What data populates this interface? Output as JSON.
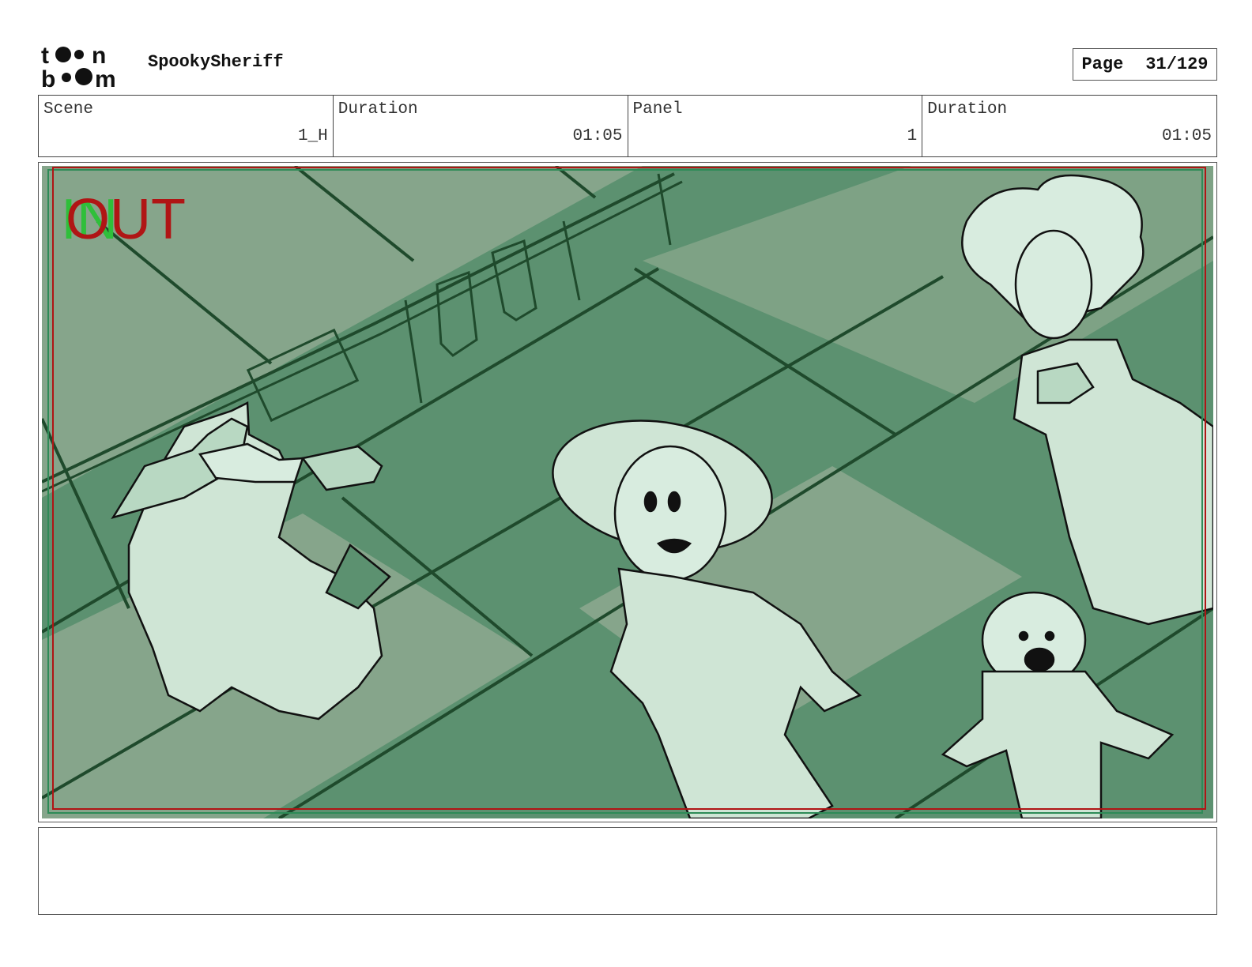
{
  "header": {
    "logo_text": "toon boom",
    "project_title": "SpookySheriff",
    "page_label": "Page",
    "page_number": "31/129"
  },
  "info": {
    "scene_label": "Scene",
    "scene_value": "1_H",
    "scene_duration_label": "Duration",
    "scene_duration_value": "01:05",
    "panel_label": "Panel",
    "panel_value": "1",
    "panel_duration_label": "Duration",
    "panel_duration_value": "01:05"
  },
  "panel": {
    "in_marker": "IN",
    "out_marker": "OUT",
    "colors": {
      "floor": "#5c9170",
      "floor_light": "#86a58b",
      "line": "#1f4a2c",
      "character_fill": "#cfe5d5",
      "in_marker": "#2fbf3a",
      "out_marker": "#b01515",
      "safe_frame": "#b01515"
    }
  },
  "caption": {
    "text": ""
  }
}
